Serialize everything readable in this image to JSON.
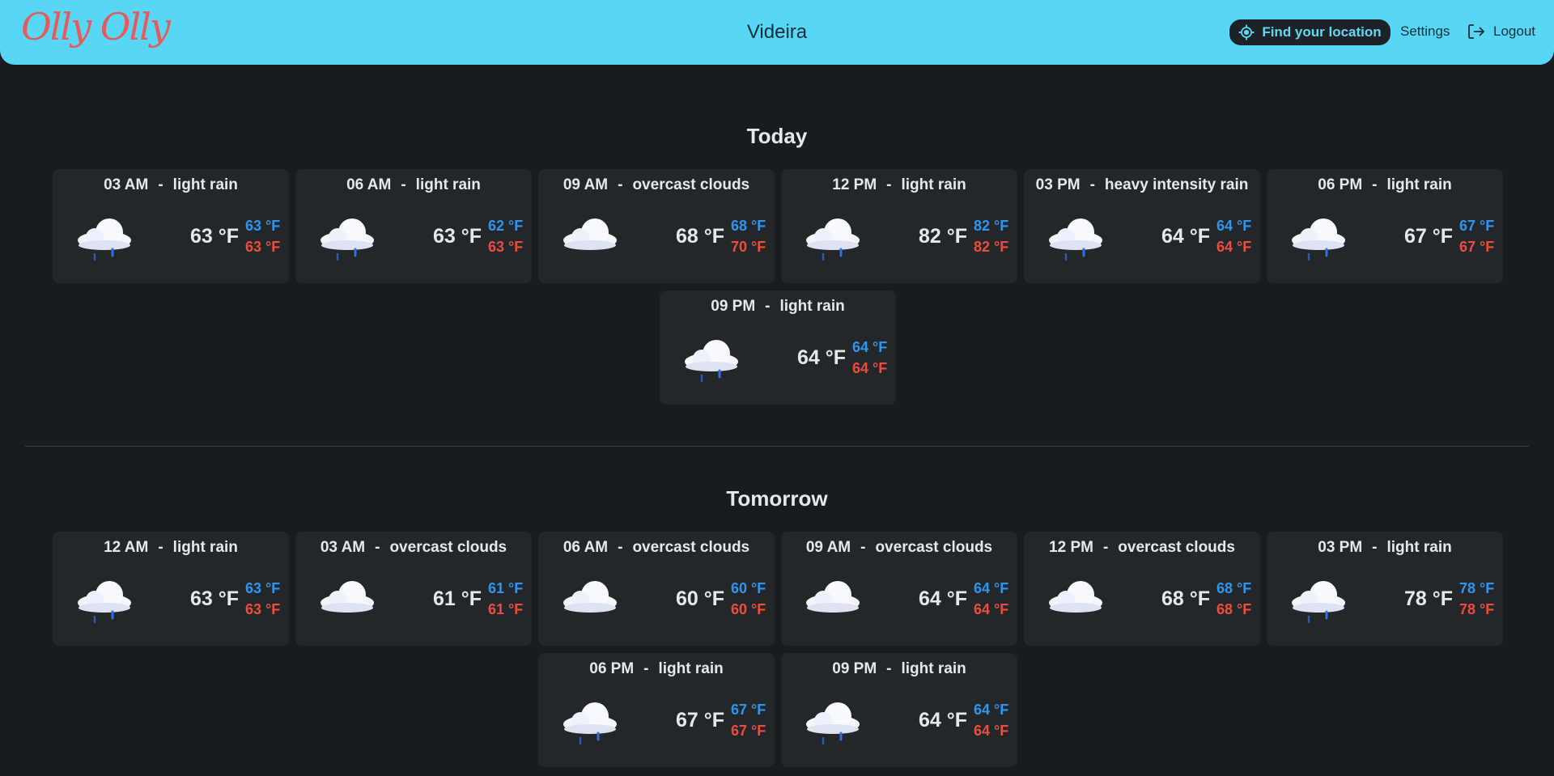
{
  "header": {
    "logo_text": "Olly Olly",
    "city": "Videira",
    "locate_label": "Find your location",
    "settings_label": "Settings",
    "logout_label": "Logout"
  },
  "colors": {
    "header_bg": "#58d6f5",
    "page_bg": "#181c1e",
    "card_bg": "#24272a",
    "min_temp": "#2c96f0",
    "max_temp": "#ef4d3c"
  },
  "sections": [
    {
      "title": "Today",
      "cards": [
        {
          "time": "03 AM",
          "desc": "light rain",
          "icon": "rain-cloud-icon",
          "temp": "63 °F",
          "min": "63 °F",
          "max": "63 °F"
        },
        {
          "time": "06 AM",
          "desc": "light rain",
          "icon": "rain-cloud-icon",
          "temp": "63 °F",
          "min": "62 °F",
          "max": "63 °F"
        },
        {
          "time": "09 AM",
          "desc": "overcast clouds",
          "icon": "cloud-icon",
          "temp": "68 °F",
          "min": "68 °F",
          "max": "70 °F"
        },
        {
          "time": "12 PM",
          "desc": "light rain",
          "icon": "rain-cloud-icon",
          "temp": "82 °F",
          "min": "82 °F",
          "max": "82 °F"
        },
        {
          "time": "03 PM",
          "desc": "heavy intensity rain",
          "icon": "rain-cloud-icon",
          "temp": "64 °F",
          "min": "64 °F",
          "max": "64 °F"
        },
        {
          "time": "06 PM",
          "desc": "light rain",
          "icon": "rain-cloud-icon",
          "temp": "67 °F",
          "min": "67 °F",
          "max": "67 °F"
        },
        {
          "time": "09 PM",
          "desc": "light rain",
          "icon": "rain-cloud-icon",
          "temp": "64 °F",
          "min": "64 °F",
          "max": "64 °F"
        }
      ]
    },
    {
      "title": "Tomorrow",
      "cards": [
        {
          "time": "12 AM",
          "desc": "light rain",
          "icon": "rain-cloud-icon",
          "temp": "63 °F",
          "min": "63 °F",
          "max": "63 °F"
        },
        {
          "time": "03 AM",
          "desc": "overcast clouds",
          "icon": "cloud-icon",
          "temp": "61 °F",
          "min": "61 °F",
          "max": "61 °F"
        },
        {
          "time": "06 AM",
          "desc": "overcast clouds",
          "icon": "cloud-icon",
          "temp": "60 °F",
          "min": "60 °F",
          "max": "60 °F"
        },
        {
          "time": "09 AM",
          "desc": "overcast clouds",
          "icon": "cloud-icon",
          "temp": "64 °F",
          "min": "64 °F",
          "max": "64 °F"
        },
        {
          "time": "12 PM",
          "desc": "overcast clouds",
          "icon": "cloud-icon",
          "temp": "68 °F",
          "min": "68 °F",
          "max": "68 °F"
        },
        {
          "time": "03 PM",
          "desc": "light rain",
          "icon": "rain-cloud-icon",
          "temp": "78 °F",
          "min": "78 °F",
          "max": "78 °F"
        },
        {
          "time": "06 PM",
          "desc": "light rain",
          "icon": "rain-cloud-icon",
          "temp": "67 °F",
          "min": "67 °F",
          "max": "67 °F"
        },
        {
          "time": "09 PM",
          "desc": "light rain",
          "icon": "rain-cloud-icon",
          "temp": "64 °F",
          "min": "64 °F",
          "max": "64 °F"
        }
      ]
    }
  ]
}
